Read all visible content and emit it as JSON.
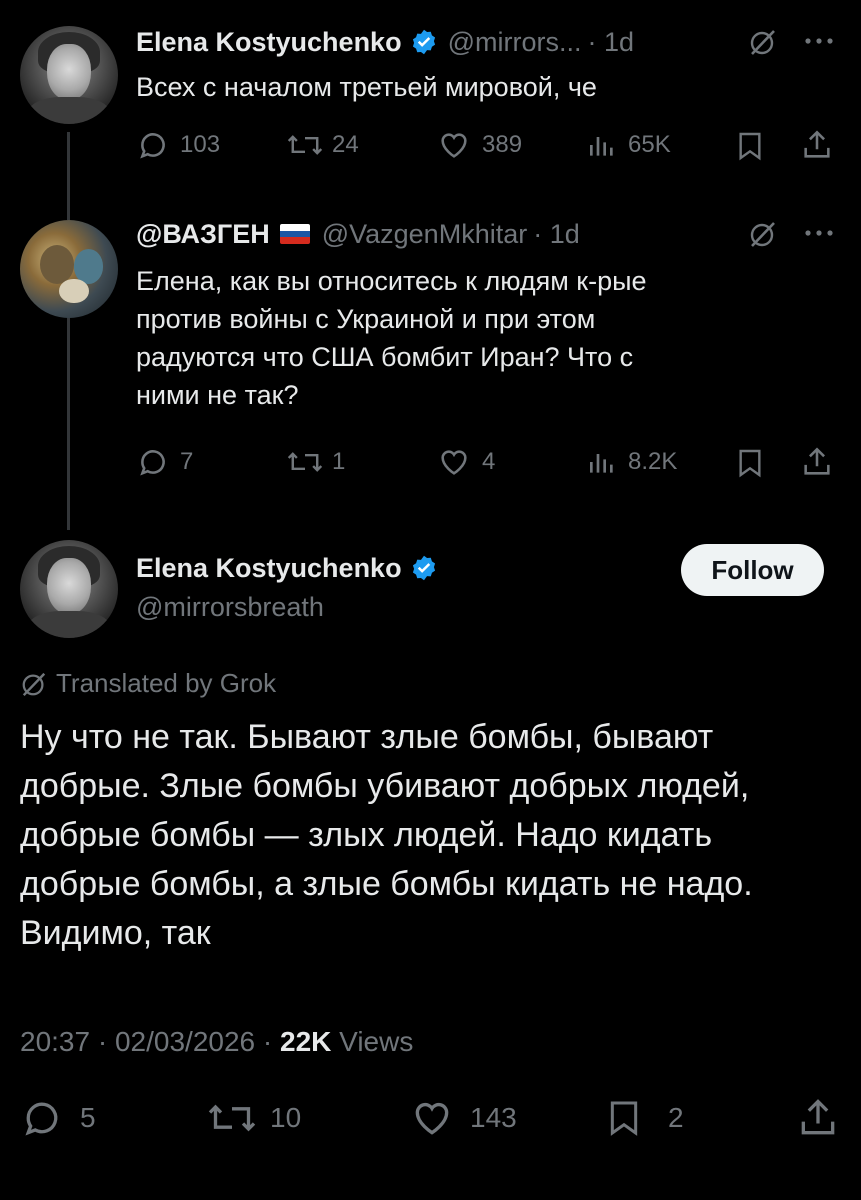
{
  "tweet1": {
    "name": "Elena Kostyuchenko",
    "handle": "@mirrors...",
    "time": "· 1d",
    "text": "Всех с началом третьей мировой, че",
    "stats": {
      "replies": "103",
      "reposts": "24",
      "likes": "389",
      "views": "65K"
    }
  },
  "tweet2": {
    "name": "@ВАЗГЕН",
    "flag": "🇷🇺",
    "handle": "@VazgenMkhitar",
    "time": "· 1d",
    "text_lines": [
      "Елена, как вы относитесь к людям к-рые",
      "против войны с Украиной и при этом",
      "радуются что США бомбит Иран? Что с",
      "ними не так?"
    ],
    "stats": {
      "replies": "7",
      "reposts": "1",
      "likes": "4",
      "views": "8.2K"
    }
  },
  "main": {
    "name": "Elena Kostyuchenko",
    "handle": "@mirrorsbreath",
    "follow_label": "Follow",
    "translated": "Translated by Grok",
    "text_lines": [
      "Ну что не так. Бывают злые бомбы, бывают",
      "добрые. Злые бомбы убивают добрых людей,",
      "добрые бомбы — злых людей. Надо кидать",
      "добрые бомбы, а злые бомбы кидать не надо.",
      "Видимо, так"
    ],
    "time": "20:37",
    "date": "02/03/2026",
    "views_count": "22K",
    "views_label": "Views",
    "stats": {
      "replies": "5",
      "reposts": "10",
      "likes": "143",
      "bookmarks": "2"
    }
  },
  "colors": {
    "background": "#000000",
    "text": "#e7e9ea",
    "muted": "#71767b",
    "verified": "#1d9bf0"
  }
}
